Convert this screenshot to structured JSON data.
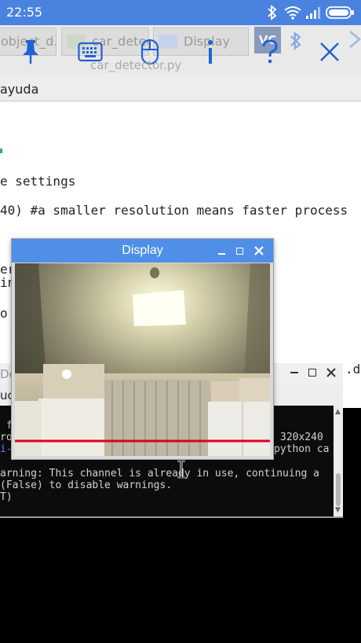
{
  "status_bar": {
    "time": "22:55",
    "icons": [
      "bluetooth-icon",
      "wifi-icon",
      "signal-icon",
      "battery-icon"
    ]
  },
  "taskbar": {
    "tasks": [
      {
        "label": "object_d..."
      },
      {
        "label": "car_detec..."
      },
      {
        "label": "Display"
      }
    ],
    "hover_title": "car_detector.py",
    "toolbar_icons": [
      "pin-icon",
      "keyboard-icon",
      "mouse-icon",
      "info-icon",
      "help-icon",
      "close-icon"
    ],
    "tray_label": "VC"
  },
  "editor": {
    "menu_help": "ayuda",
    "lines": [
      "e settings",
      "40) #a smaller resolution means faster process",
      "er.",
      "in",
      "o"
    ],
    "right_fragment": ".de"
  },
  "terminal": {
    "title_fragment": "Do",
    "menu_fragment": "uc",
    "lines": [
      {
        "left": " f",
        "right": ""
      },
      {
        "left": "ro",
        "right": "320x240"
      },
      {
        "left": "i-",
        "right": "python ca"
      },
      {
        "left": "",
        "right": ""
      },
      {
        "left": "arning: This channel is already in use, continuing a",
        "right": ""
      },
      {
        "left": "(False) to disable warnings.",
        "right": ""
      },
      {
        "left": "T)",
        "right": ""
      }
    ]
  },
  "display_window": {
    "title": "Display",
    "detection_line_color": "#e0001a",
    "tracked_point_color": "#ffffff"
  },
  "colors": {
    "status_bar": "#4a82e0",
    "title_bar": "#4f8fe8",
    "toolbar_icon": "#1e62d6"
  }
}
